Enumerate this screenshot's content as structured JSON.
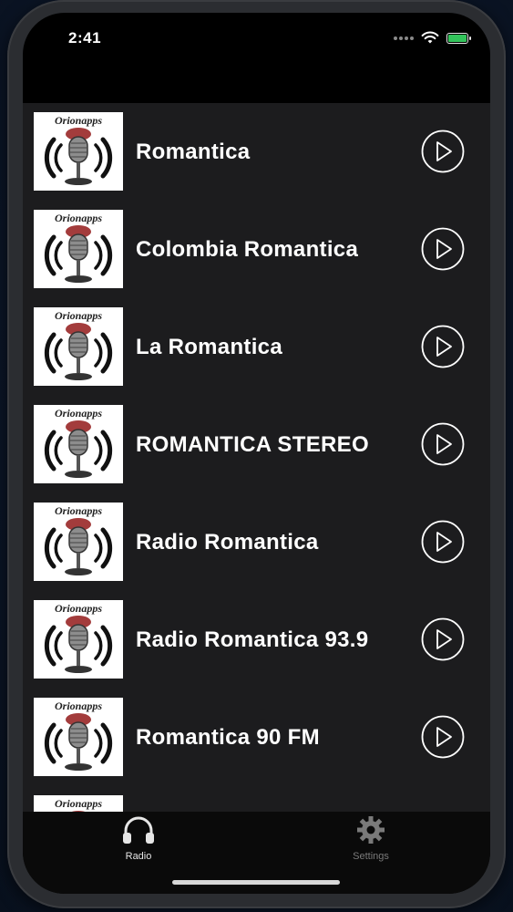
{
  "status_bar": {
    "time": "2:41",
    "battery_icon": "battery-icon",
    "wifi_icon": "wifi-icon",
    "battery_color": "#33c35b"
  },
  "logo_text": "Orionapps",
  "stations": [
    {
      "name": "Romantica"
    },
    {
      "name": "Colombia Romantica"
    },
    {
      "name": "La Romantica"
    },
    {
      "name": "ROMANTICA STEREO"
    },
    {
      "name": "Radio Romantica"
    },
    {
      "name": "Radio Romantica 93.9"
    },
    {
      "name": "Romantica 90 FM"
    },
    {
      "name": ""
    }
  ],
  "tabs": {
    "radio": {
      "label": "Radio",
      "icon": "headphones-icon"
    },
    "settings": {
      "label": "Settings",
      "icon": "gear-icon"
    }
  },
  "colors": {
    "list_background": "#1c1c1e",
    "tab_background": "#0a0a0a",
    "text": "#ffffff"
  }
}
